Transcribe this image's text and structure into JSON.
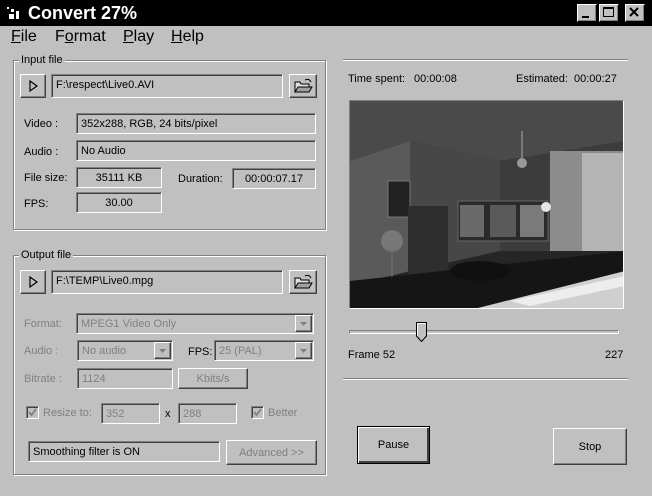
{
  "window": {
    "title": "Convert 27%"
  },
  "menu": [
    {
      "label": "File",
      "u": "F",
      "rest": "ile"
    },
    {
      "label": "Format",
      "u": "o",
      "pre": "F",
      "rest": "rmat"
    },
    {
      "label": "Play",
      "u": "P",
      "rest": "lay"
    },
    {
      "label": "Help",
      "u": "H",
      "rest": "elp"
    }
  ],
  "input": {
    "group_label": "Input file",
    "path": "F:\\respect\\Live0.AVI",
    "video_label": "Video :",
    "video_value": "352x288, RGB, 24 bits/pixel",
    "audio_label": "Audio :",
    "audio_value": "No Audio",
    "filesize_label": "File size:",
    "filesize_value": "35111 KB",
    "duration_label": "Duration:",
    "duration_value": "00:00:07.17",
    "fps_label": "FPS:",
    "fps_value": "30.00"
  },
  "output": {
    "group_label": "Output file",
    "path": "F:\\TEMP\\Live0.mpg",
    "format_label": "Format:",
    "format_value": "MPEG1 Video Only",
    "audio_label": "Audio :",
    "audio_value": "No audio",
    "fps_label": "FPS:",
    "fps_value": "25 (PAL)",
    "bitrate_label": "Bitrate :",
    "bitrate_value": "1124",
    "bitrate_unit": "Kbits/s",
    "resize_label": "Resize to:",
    "resize_checked": true,
    "width_value": "352",
    "x_label": "x",
    "height_value": "288",
    "better_label": "Better",
    "better_checked": true,
    "smoothing_status": "Smoothing filter is ON",
    "advanced_label": "Advanced >>"
  },
  "progress": {
    "time_spent_label": "Time spent:",
    "time_spent_value": "00:00:08",
    "estimated_label": "Estimated:",
    "estimated_value": "00:00:27",
    "frame_label": "Frame 52",
    "total_frames": "227",
    "slider_fraction": 0.27
  },
  "buttons": {
    "pause": "Pause",
    "stop": "Stop"
  },
  "icons": {
    "play": "play-icon",
    "folder": "folder-open-icon",
    "minimize": "minimize-icon",
    "maximize": "maximize-icon",
    "close": "close-icon"
  }
}
